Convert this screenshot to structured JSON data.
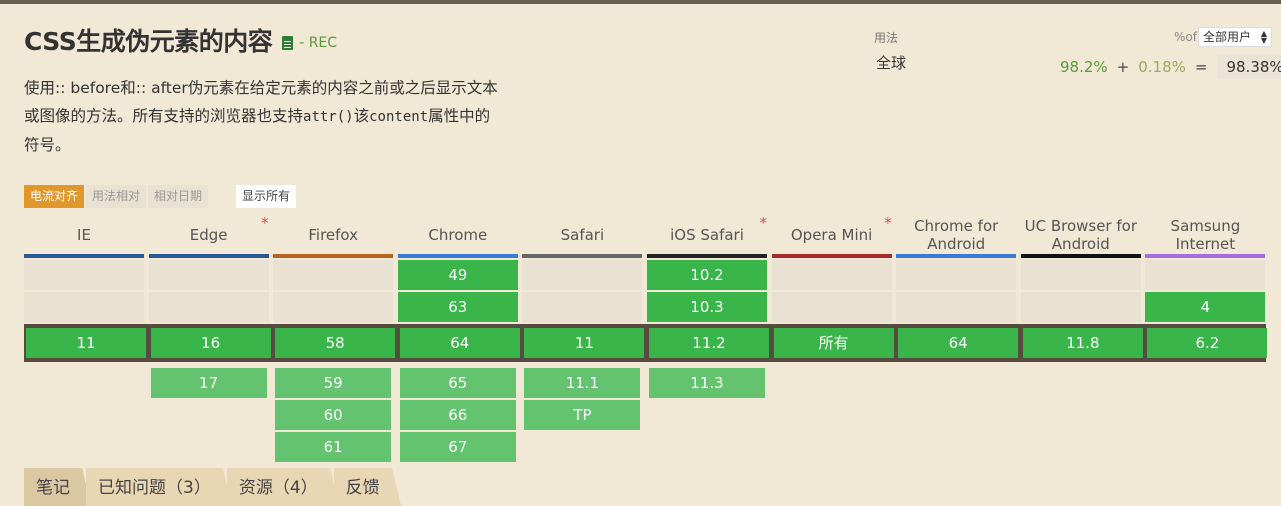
{
  "header": {
    "title": "CSS生成伪元素的内容",
    "status": "- REC",
    "description_line1": "使用:: before和:: after伪元素在给定元素的内容之前或之后显示文本",
    "description_line2_a": "或图像的方法。所有支持的浏览器也支持",
    "description_line2_code1": "attr()",
    "description_line2_b": "该",
    "description_line2_code2": "content",
    "description_line2_c": "属性中的",
    "description_line3": "符号。"
  },
  "usage": {
    "label": "用法",
    "region": "全球",
    "pct_of": "%of",
    "user_select": "全部用户",
    "full": "98.2%",
    "plus": "+",
    "partial": "0.18%",
    "equals": "=",
    "total": "98.38%"
  },
  "filters": {
    "current_aligned": "电流对齐",
    "usage_relative": "用法相对",
    "date_relative": "相对日期",
    "show_all": "显示所有"
  },
  "colors": {
    "supported": "#39b54a",
    "supported_future": "#64c36f",
    "accent": "#e0982a",
    "note_star": "#d9534f"
  },
  "browsers": [
    {
      "name": "IE",
      "bar_color": "#2b5797",
      "star": "",
      "past": [],
      "current": "11",
      "future": []
    },
    {
      "name": "Edge",
      "bar_color": "#2b5797",
      "star": "*",
      "past": [],
      "current": "16",
      "future": [
        "17"
      ]
    },
    {
      "name": "Firefox",
      "bar_color": "#b5651d",
      "star": "",
      "past": [],
      "current": "58",
      "future": [
        "59",
        "60",
        "61"
      ]
    },
    {
      "name": "Chrome",
      "bar_color": "#3b7bd4",
      "star": "",
      "past": [
        "49",
        "63"
      ],
      "current": "64",
      "future": [
        "65",
        "66",
        "67"
      ]
    },
    {
      "name": "Safari",
      "bar_color": "#666666",
      "star": "",
      "past": [],
      "current": "11",
      "future": [
        "11.1",
        "TP"
      ]
    },
    {
      "name": "iOS Safari",
      "bar_color": "#222222",
      "star": "*",
      "past": [
        "10.2",
        "10.3"
      ],
      "current": "11.2",
      "future": [
        "11.3"
      ]
    },
    {
      "name": "Opera Mini",
      "bar_color": "#a52a2a",
      "star": "*",
      "past": [],
      "current": "所有",
      "future": []
    },
    {
      "name": "Chrome for Android",
      "bar_color": "#3b7bd4",
      "star": "",
      "past": [],
      "current": "64",
      "future": []
    },
    {
      "name": "UC Browser for Android",
      "bar_color": "#111111",
      "star": "",
      "past": [],
      "current": "11.8",
      "future": []
    },
    {
      "name": "Samsung Internet",
      "bar_color": "#a56de2",
      "star": "",
      "past": [
        "4"
      ],
      "current": "6.2",
      "future": []
    }
  ],
  "tabs": [
    {
      "label": "笔记"
    },
    {
      "label": "已知问题（3）"
    },
    {
      "label": "资源（4）"
    },
    {
      "label": "反馈"
    }
  ]
}
